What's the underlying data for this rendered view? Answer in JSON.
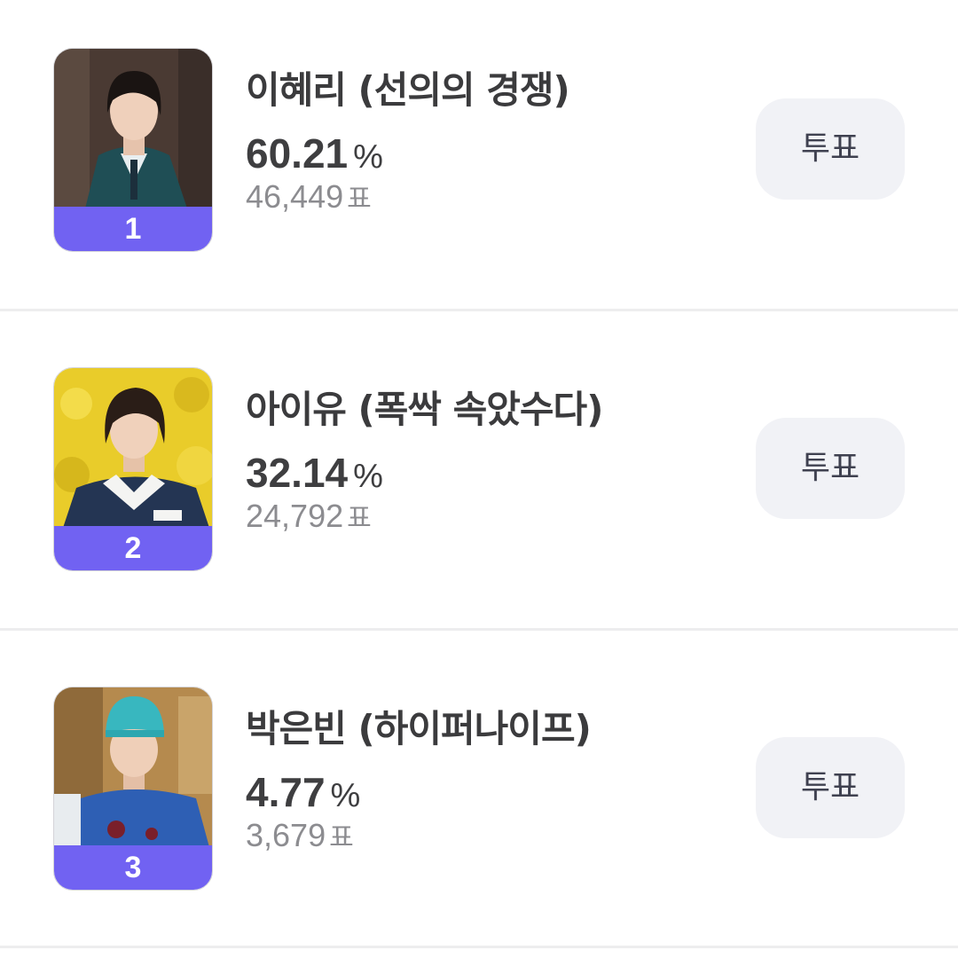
{
  "candidates": [
    {
      "rank": "1",
      "name": "이혜리 (선의의 경쟁)",
      "percent": "60.21",
      "percent_unit": "%",
      "votes": "46,449",
      "votes_unit": "표",
      "vote_button_label": "투표"
    },
    {
      "rank": "2",
      "name": "아이유 (폭싹 속았수다)",
      "percent": "32.14",
      "percent_unit": "%",
      "votes": "24,792",
      "votes_unit": "표",
      "vote_button_label": "투표"
    },
    {
      "rank": "3",
      "name": "박은빈 (하이퍼나이프)",
      "percent": "4.77",
      "percent_unit": "%",
      "votes": "3,679",
      "votes_unit": "표",
      "vote_button_label": "투표"
    }
  ],
  "colors": {
    "rank_badge": "#7162f2",
    "button_bg": "#f1f2f6",
    "divider": "#ededee"
  }
}
